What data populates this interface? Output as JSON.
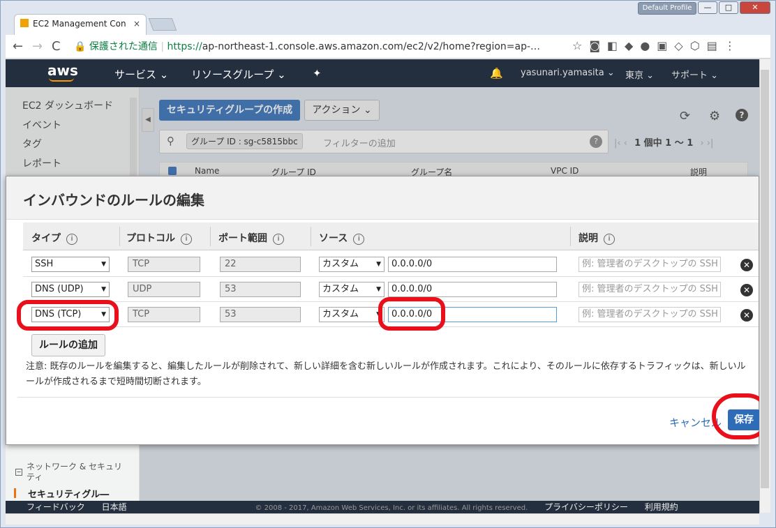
{
  "window": {
    "profile": "Default Profile",
    "min": "—",
    "max": "□",
    "close": "✕"
  },
  "browser": {
    "tab_title": "EC2 Management Con",
    "tab_close": "×",
    "back": "←",
    "forward": "→",
    "reload": "C",
    "lock": "🔒",
    "security_text": "保護された通信",
    "url_scheme": "https://",
    "url_rest": "ap-northeast-1.console.aws.amazon.com/ec2/v2/home?region=ap-…",
    "star": "☆",
    "menu": "⋮"
  },
  "aws_nav": {
    "logo": "aws",
    "services": "サービス ⌄",
    "resource_groups": "リソースグループ ⌄",
    "pin": "✦",
    "bell": "🔔",
    "user": "yasunari.yamasita ⌄",
    "region": "東京 ⌄",
    "support": "サポート ⌄"
  },
  "sidebar": {
    "items": [
      "EC2 ダッシュボード",
      "イベント",
      "タグ",
      "レポート"
    ],
    "section": "ネットワーク & セキュリ\nティ",
    "current": "セキュリティグル―"
  },
  "main": {
    "create_button": "セキュリティグループの作成",
    "action_button": "アクション ⌄",
    "filter_chip": "グループ ID : sg-c5815bbc",
    "filter_placeholder": "フィルターの追加",
    "pager": "1 個中 1 ～ 1",
    "columns": [
      "Name",
      "グループ ID",
      "グループ名",
      "VPC ID",
      "説明"
    ]
  },
  "modal": {
    "title": "インバウンドのルールの編集",
    "headers": {
      "type": "タイプ",
      "protocol": "プロトコル",
      "port": "ポート範囲",
      "source": "ソース",
      "description": "説明"
    },
    "info": "i",
    "rules": [
      {
        "type": "SSH",
        "protocol": "TCP",
        "port": "22",
        "source_type": "カスタム",
        "source": "0.0.0.0/0",
        "desc_placeholder": "例: 管理者のデスクトップの SSH"
      },
      {
        "type": "DNS (UDP)",
        "protocol": "UDP",
        "port": "53",
        "source_type": "カスタム",
        "source": "0.0.0.0/0",
        "desc_placeholder": "例: 管理者のデスクトップの SSH"
      },
      {
        "type": "DNS (TCP)",
        "protocol": "TCP",
        "port": "53",
        "source_type": "カスタム",
        "source": "0.0.0.0/0",
        "desc_placeholder": "例: 管理者のデスクトップの SSH"
      }
    ],
    "add_rule": "ルールの追加",
    "note": "注意: 既存のルールを編集すると、編集したルールが削除されて、新しい詳細を含む新しいルールが作成されます。これにより、そのルールに依存するトラフィックは、新しいルールが作成されるまで短時間切断されます。",
    "cancel": "キャンセル",
    "save": "保存"
  },
  "footer": {
    "feedback": "フィードバック",
    "language": "日本語",
    "copyright": "© 2008 - 2017, Amazon Web Services, Inc. or its affiliates. All rights reserved.",
    "privacy": "プライバシーポリシー",
    "terms": "利用規約"
  }
}
